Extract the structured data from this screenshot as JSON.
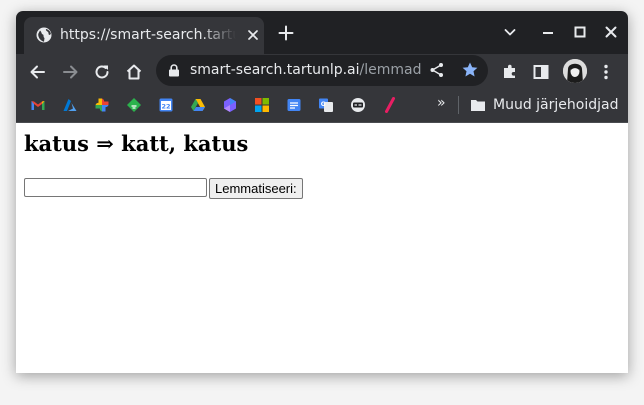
{
  "browser": {
    "tab": {
      "title": "https://smart-search.tartunlp.ai/lemmad"
    },
    "omnibox": {
      "host": "smart-search.tartunlp.ai",
      "path": "/lemmad"
    },
    "bookmarks": {
      "icons": [
        "gmail-icon",
        "azure-icon",
        "photos-icon",
        "feedly-icon",
        "calendar-icon",
        "drive-icon",
        "pinwheel-icon",
        "microsoft-icon",
        "google-form-icon",
        "google-translate-icon",
        "subtitles-icon",
        "slash-icon"
      ],
      "overflow": "»",
      "other_bookmarks": "Muud järjehoidjad"
    },
    "colors": {
      "tabstrip": "#202124",
      "toolbar": "#35363a",
      "star": "#8ab4f8"
    }
  },
  "page": {
    "heading": "katus ⇒ katt, katus",
    "input_value": "",
    "button_label": "Lemmatiseeri:"
  }
}
